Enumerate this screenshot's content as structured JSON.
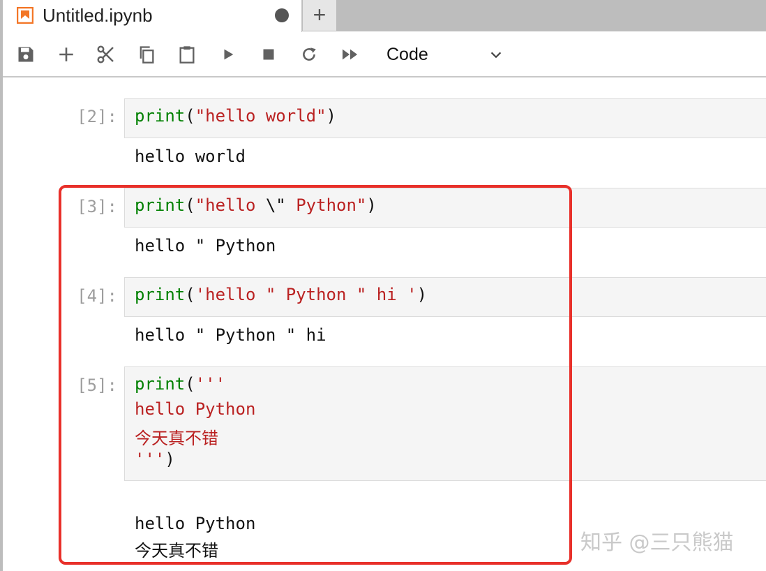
{
  "tab": {
    "title": "Untitled.ipynb",
    "icon": "notebook-icon",
    "new_tab_label": "+"
  },
  "toolbar": {
    "buttons": [
      "save-icon",
      "add-icon",
      "cut-icon",
      "copy-icon",
      "paste-icon",
      "run-icon",
      "stop-icon",
      "restart-icon",
      "run-all-icon"
    ],
    "cell_type": "Code"
  },
  "cells": [
    {
      "prompt": "[2]:",
      "code": [
        "print(\"hello world\")"
      ],
      "output": [
        "hello world"
      ]
    },
    {
      "prompt": "[3]:",
      "code": [
        "print(\"hello \\\" Python\")"
      ],
      "output": [
        "hello \" Python"
      ]
    },
    {
      "prompt": "[4]:",
      "code": [
        "print('hello \" Python \" hi ')"
      ],
      "output": [
        "hello \" Python \" hi"
      ]
    },
    {
      "prompt": "[5]:",
      "code": [
        "print('''",
        "hello Python",
        "今天真不错",
        "''')"
      ],
      "output": [
        "",
        "hello Python",
        "今天真不错"
      ]
    }
  ],
  "watermark": "知乎 @三只熊猫",
  "colors": {
    "keyword": "#008000",
    "string": "#ba2121",
    "highlight": "#e8302a",
    "accent": "#f37626"
  }
}
